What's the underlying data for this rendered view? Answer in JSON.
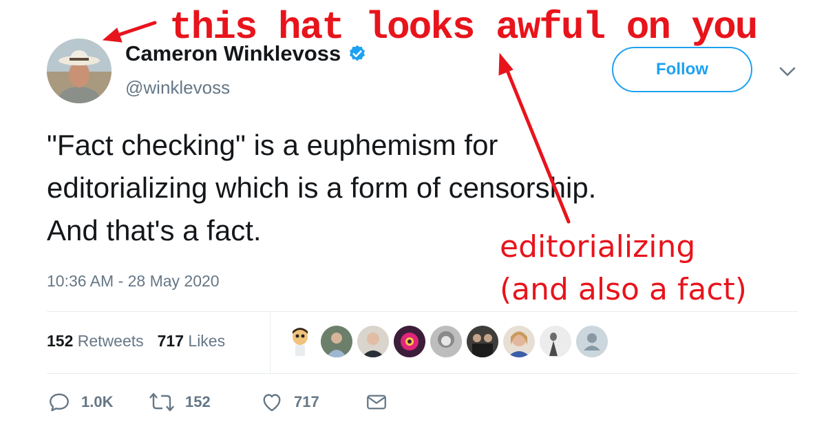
{
  "tweet": {
    "display_name": "Cameron Winklevoss",
    "verified_icon": "verified-badge-icon",
    "handle": "@winklevoss",
    "follow_label": "Follow",
    "text_lines": [
      "\"Fact checking\" is a euphemism for",
      "editorializing which is a form of censorship.",
      "And that's a fact."
    ],
    "timestamp": "10:36 AM - 28 May 2020",
    "stats": {
      "retweets_count": "152",
      "retweets_label": "Retweets",
      "likes_count": "717",
      "likes_label": "Likes"
    },
    "actions": {
      "reply_count": "1.0K",
      "retweet_count": "152",
      "like_count": "717"
    },
    "liker_avatar_count": 10
  },
  "annotations": {
    "top": "this hat looks awful on you",
    "right_line1": "editorializing",
    "right_line2": "(and also a fact)"
  },
  "colors": {
    "brand_blue": "#1da1f2",
    "annotation_red": "#e8141c",
    "secondary_text": "#657786",
    "primary_text": "#14171a"
  }
}
